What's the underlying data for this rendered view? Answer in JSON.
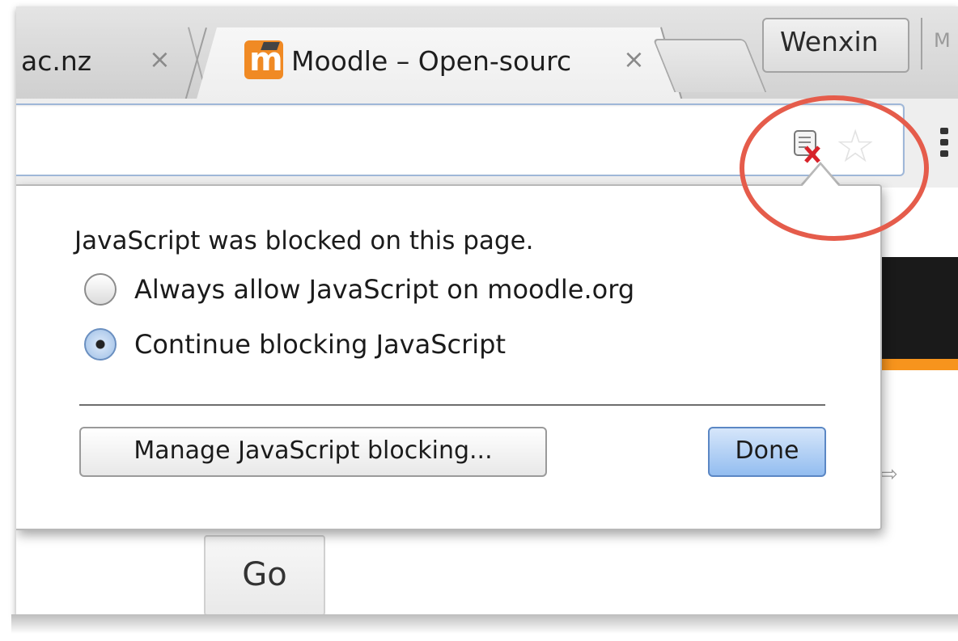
{
  "tabs": [
    {
      "title": "ac.nz",
      "close": "×",
      "active": false
    },
    {
      "title": "Moodle – Open-sourc",
      "close": "×",
      "active": true,
      "favicon": "moodle-favicon-icon"
    }
  ],
  "profile": {
    "name": "Wenxin",
    "extra": "M"
  },
  "toolbar": {
    "address_value": "",
    "jsblock_icon": "javascript-blocked-icon",
    "star": "☆",
    "menu_icon": "menu-icon"
  },
  "popup": {
    "title": "JavaScript was blocked on this page.",
    "options": [
      {
        "label": "Always allow JavaScript on moodle.org",
        "selected": false
      },
      {
        "label": "Continue blocking JavaScript",
        "selected": true
      }
    ],
    "manage_label": "Manage JavaScript blocking...",
    "done_label": "Done"
  },
  "page": {
    "go_label": "Go",
    "arrow_hint": "⇨"
  },
  "colors": {
    "highlight_circle": "#e55c4b",
    "moodle_orange": "#f08a24",
    "done_button": "#93bdf0",
    "page_accent": "#f7941d"
  }
}
